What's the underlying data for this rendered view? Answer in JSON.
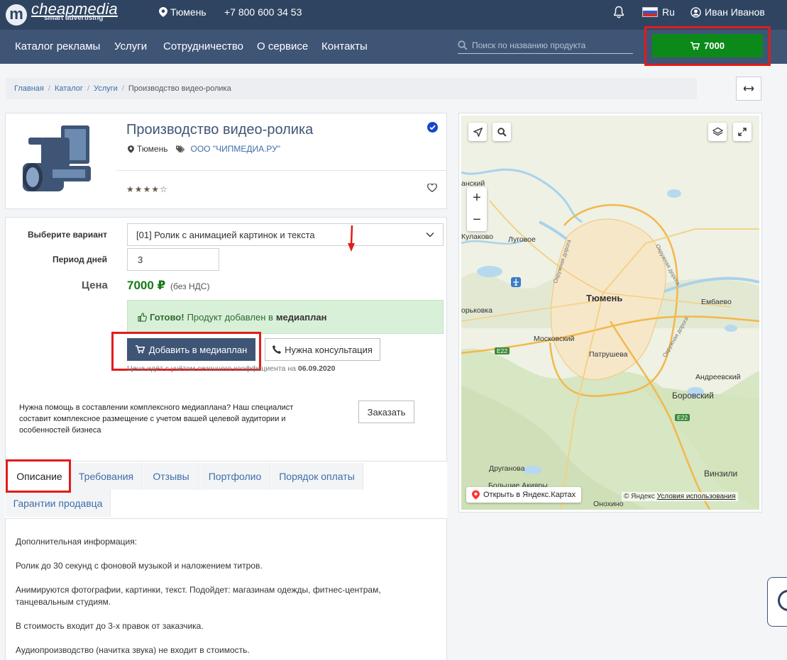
{
  "header": {
    "logo_mark": "m",
    "logo_text": "cheapmedia",
    "logo_sub": "smart advertising",
    "city": "Тюмень",
    "phone": "+7 800 600 34 53",
    "lang": "Ru",
    "user": "Иван Иванов"
  },
  "nav": {
    "items": [
      "Каталог рекламы",
      "Услуги",
      "Сотрудничество",
      "О сервисе",
      "Контакты"
    ],
    "search_placeholder": "Поиск по названию продукта",
    "cart_total": "7000"
  },
  "breadcrumb": {
    "items": [
      "Главная",
      "Каталог",
      "Услуги"
    ],
    "current": "Производство видео-ролика"
  },
  "product": {
    "title": "Производство видео-ролика",
    "city": "Тюмень",
    "company": "ООО \"ЧИПМЕДИА.РУ\"",
    "rating": 4,
    "rating_max": 5
  },
  "options": {
    "variant_label": "Выберите вариант",
    "variant_value": "[01] Ролик с анимацией картинок и текста",
    "period_label": "Период дней",
    "period_value": "3",
    "price_label": "Цена",
    "price_value": "7000 ₽",
    "vat_note": "(без НДС)",
    "ready_bold": "Готово!",
    "ready_text": "Продукт добавлен в",
    "ready_target": "медиаплан",
    "add_button": "Добавить в медиаплан",
    "consult_button": "Нужна консультация",
    "note_text": "Цена идёт с учётом сезонного коэффициента на",
    "note_date": "06.09.2020",
    "help_text": "Нужна помощь в составлении комплексного медиаплана? Наш специалист составит комплексное размещение с учетом вашей целевой аудитории и особенностей бизнеса",
    "order_button": "Заказать"
  },
  "tabs": [
    "Описание",
    "Требования",
    "Отзывы",
    "Портфолио",
    "Порядок оплаты",
    "Гарантии продавца"
  ],
  "description": [
    "Дополнительная информация:",
    "Ролик до 30 секунд с фоновой музыкой и наложением титров.",
    "Анимируются фотографии, картинки, текст. Подойдет: магазинам одежды, фитнес-центрам, танцевальным студиям.",
    "В стоимость входит до 3-х правок от заказчика.",
    "Аудиопроизводство (начитка звука) не входит в стоимость."
  ],
  "map": {
    "labels": [
      "анский",
      "Кулаково",
      "Луговое",
      "Тюмень",
      "Ембаево",
      "орьковка",
      "Московский",
      "Патрушева",
      "Андреевский",
      "Боровский",
      "Друганова",
      "Винзили",
      "Большие Акияры",
      "Онохино",
      "E22",
      "E22",
      "Окружная дорога",
      "Окружная дорога",
      "Окружная дорога"
    ],
    "open_link": "Открыть в Яндекс.Картах",
    "copyright": "© Яндекс",
    "terms": "Условия использования"
  }
}
